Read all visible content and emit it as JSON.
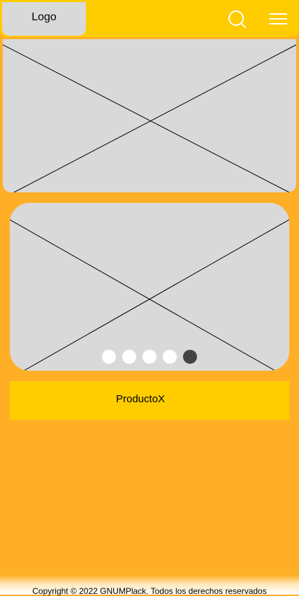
{
  "colors": {
    "background": "#ffaf26",
    "header": "#ffcc00",
    "placeholder": "#d9d9d9",
    "dot_inactive": "#ffffff",
    "dot_active": "#444444"
  },
  "header": {
    "logo_text": "Logo",
    "search_icon": "search-icon",
    "menu_icon": "hamburger-menu-icon"
  },
  "carousel": {
    "slide_count": 5,
    "active_index": 4
  },
  "product": {
    "name": "ProductoX"
  },
  "footer": {
    "text": "Copyright © 2022 GNUMPlack. Todos los derechos reservados"
  }
}
